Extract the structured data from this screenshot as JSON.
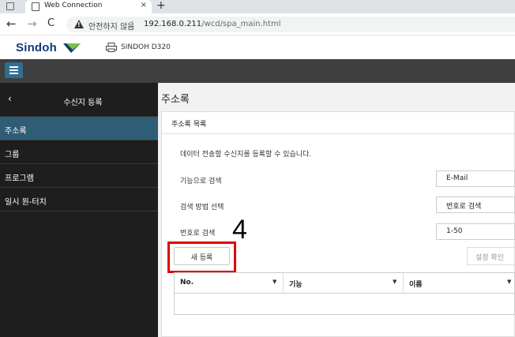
{
  "browser": {
    "tab_title": "Web Connection",
    "tab_close": "×",
    "new_tab": "+",
    "back": "←",
    "forward": "→",
    "reload": "C",
    "security_label": "안전하지 않음",
    "separator": "|",
    "url_host": "192.168.0.211",
    "url_path": "/wcd/spa_main.html"
  },
  "app_header": {
    "brand": "Sindoh",
    "device_name": "SINDOH D320"
  },
  "sidebar": {
    "back_icon": "chevron-left-icon",
    "back_glyph": "‹",
    "title": "수신지 등록",
    "items": [
      {
        "label": "주소록",
        "active": true
      },
      {
        "label": "그룹",
        "active": false
      },
      {
        "label": "프로그램",
        "active": false
      },
      {
        "label": "일시 원-터치",
        "active": false
      }
    ]
  },
  "main": {
    "title": "주소록",
    "panel_title": "주소록 목록",
    "description": "데이터 전송할 수신지를 등록할 수 있습니다.",
    "search_by_function": {
      "label": "기능으로 검색",
      "value": "E-Mail"
    },
    "search_method": {
      "label": "검색 방법 선택",
      "value": "번호로 검색"
    },
    "search_by_number": {
      "label": "번호로 검색",
      "value": "1-50"
    },
    "annotation_number": "4",
    "new_register_button": "새 등록",
    "confirm_settings_button": "설정 확인",
    "table": {
      "caret": "▼",
      "columns": [
        "No.",
        "기능",
        "이름"
      ]
    }
  },
  "colors": {
    "brand_blue": "#0f3a78",
    "brand_green": "#7cc242",
    "sidebar_bg": "#1e1e1e",
    "sidebar_active": "#2f5d78",
    "menu_button": "#2f6e92",
    "highlight": "#e10000"
  }
}
